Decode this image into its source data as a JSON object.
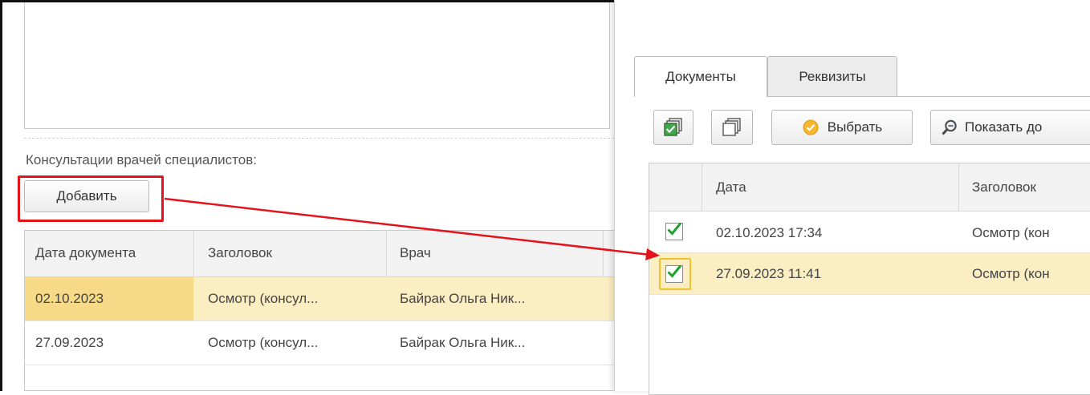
{
  "left": {
    "section_label": "Консультации врачей специалистов:",
    "add_button": "Добавить",
    "table": {
      "columns": [
        "Дата документа",
        "Заголовок",
        "Врач"
      ],
      "rows": [
        {
          "date": "02.10.2023",
          "title": "Осмотр (консул...",
          "doctor": "Байрак Ольга Ник...",
          "selected": true
        },
        {
          "date": "27.09.2023",
          "title": "Осмотр (консул...",
          "doctor": "Байрак Ольга Ник...",
          "selected": false
        }
      ]
    }
  },
  "right": {
    "tabs": [
      "Документы",
      "Реквизиты"
    ],
    "toolbar": {
      "select_button": "Выбрать",
      "show_button": "Показать до"
    },
    "table": {
      "columns": [
        "Дата",
        "Заголовок"
      ],
      "rows": [
        {
          "date": "02.10.2023 17:34",
          "title": "Осмотр (кон",
          "checked": true,
          "selected": false
        },
        {
          "date": "27.09.2023 11:41",
          "title": "Осмотр (кон",
          "checked": true,
          "selected": true
        }
      ]
    }
  },
  "colors": {
    "highlight_red": "#e3131b",
    "selected_row": "#fbeec2",
    "selected_cell": "#f7da88",
    "check_green": "#1fa12d",
    "focus_yellow": "#f2c12e"
  }
}
